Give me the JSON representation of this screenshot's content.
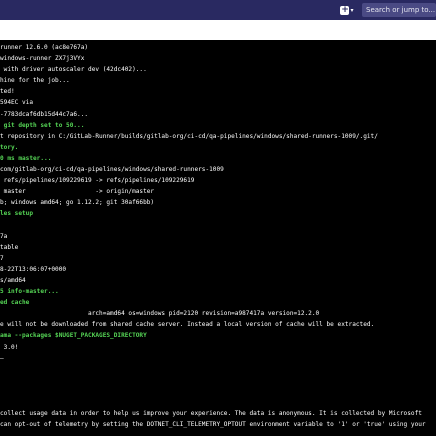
{
  "header": {
    "new_icon": "plus-square-icon",
    "new_chevron": "▾",
    "search_placeholder": "Search or jump to..."
  },
  "terminal": {
    "lines": [
      {
        "text": "runner 12.6.0 (ac8e767a)",
        "color": "white",
        "bold": false
      },
      {
        "text": "windows-runner ZX7j3VYx",
        "color": "white",
        "bold": false
      },
      {
        "text": " with driver autoscaler dev (42dc402)...",
        "color": "white",
        "bold": false
      },
      {
        "text": "hine for the job...",
        "color": "white",
        "bold": false
      },
      {
        "text": "ted!",
        "color": "white",
        "bold": false
      },
      {
        "text": "594EC via",
        "color": "white",
        "bold": false
      },
      {
        "text": "-7783dcaf6db15d44c7a6...",
        "color": "white",
        "bold": false
      },
      {
        "text": " git depth set to 50...",
        "color": "green",
        "bold": true
      },
      {
        "text": "t repository in C:/GitLab-Runner/builds/gitlab-org/ci-cd/qa-pipelines/windows/shared-runners-1009/.git/",
        "color": "white",
        "bold": false
      },
      {
        "text": "tory.",
        "color": "green",
        "bold": true
      },
      {
        "text": "0 ms master...",
        "color": "green",
        "bold": true
      },
      {
        "text": "com/gitlab-org/ci-cd/qa-pipelines/windows/shared-runners-1009",
        "color": "white",
        "bold": false
      },
      {
        "text": " refs/pipelines/109229619 -> refs/pipelines/109229619",
        "color": "white",
        "bold": false
      },
      {
        "text": " master                   -> origin/master",
        "color": "white",
        "bold": false
      },
      {
        "text": "b; windows amd64; go 1.12.2; git 30af66bb)",
        "color": "white",
        "bold": false
      },
      {
        "text": "les setup",
        "color": "green",
        "bold": true
      },
      {
        "text": "",
        "color": "white",
        "bold": false
      },
      {
        "text": "7a",
        "color": "white",
        "bold": false
      },
      {
        "text": "table",
        "color": "white",
        "bold": false
      },
      {
        "text": "7",
        "color": "white",
        "bold": false
      },
      {
        "text": "8-22T13:06:07+0000",
        "color": "white",
        "bold": false
      },
      {
        "text": "s/amd64",
        "color": "white",
        "bold": false
      },
      {
        "text": "5 info-master...",
        "color": "green",
        "bold": true
      },
      {
        "text": "ed cache",
        "color": "green",
        "bold": true
      },
      {
        "text": "                        arch=amd64 os=windows pid=2120 revision=a987417a version=12.2.0",
        "color": "white",
        "bold": false
      },
      {
        "text": "e will not be downloaded from shared cache server. Instead a local version of cache will be extracted.",
        "color": "white",
        "bold": false
      },
      {
        "text": "ama --packages $NUGET_PACKAGES_DIRECTORY",
        "color": "green",
        "bold": true
      },
      {
        "text": " 3.0!",
        "color": "white",
        "bold": false
      },
      {
        "text": "—",
        "color": "white",
        "bold": false
      },
      {
        "text": "",
        "color": "white",
        "bold": false
      },
      {
        "text": "",
        "color": "white",
        "bold": false
      },
      {
        "text": "",
        "color": "white",
        "bold": false
      },
      {
        "text": "",
        "color": "white",
        "bold": false
      },
      {
        "text": "collect usage data in order to help us improve your experience. The data is anonymous. It is collected by Microsoft",
        "color": "white",
        "bold": false
      },
      {
        "text": "can opt-out of telemetry by setting the DOTNET_CLI_TELEMETRY_OPTOUT environment variable to '1' or 'true' using your",
        "color": "white",
        "bold": false
      }
    ]
  }
}
